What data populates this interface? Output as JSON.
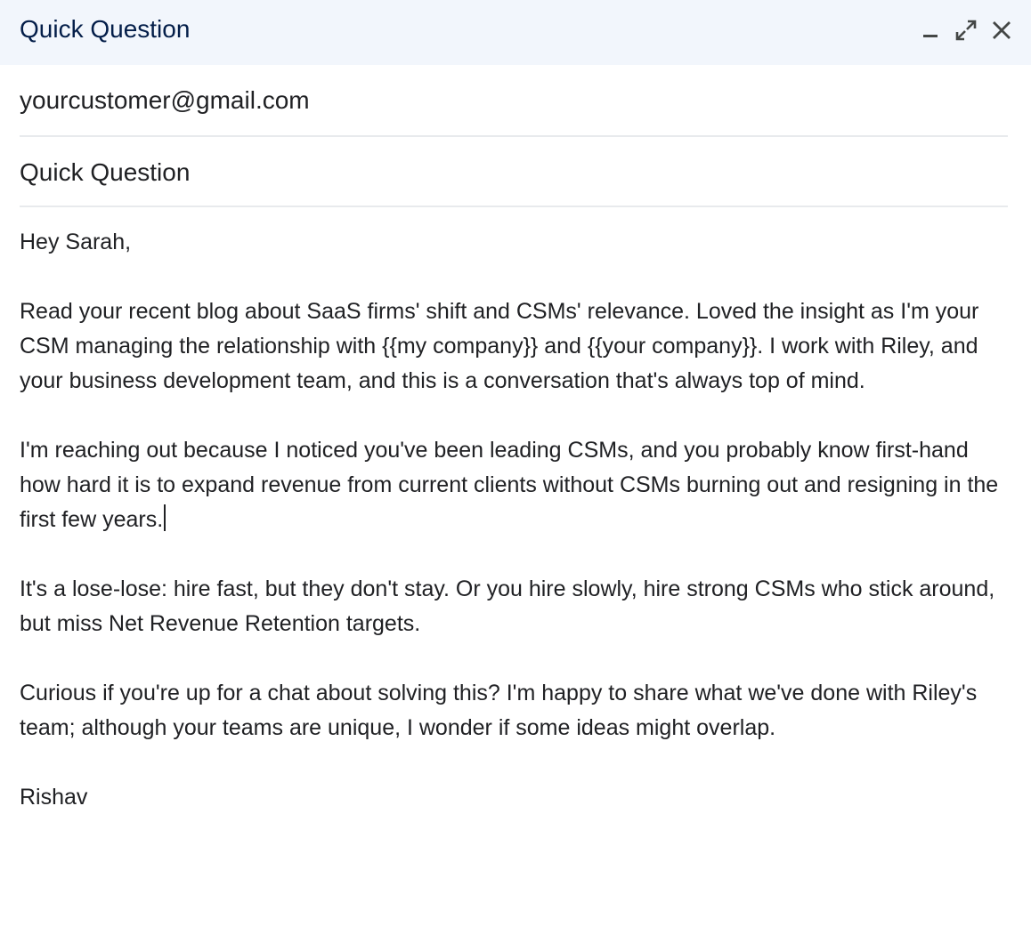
{
  "window": {
    "title": "Quick Question",
    "controls": [
      "minimize-icon",
      "expand-icon",
      "close-icon"
    ]
  },
  "compose": {
    "to": "yourcustomer@gmail.com",
    "subject": "Quick Question"
  },
  "message": {
    "greeting": "Hey Sarah,",
    "paragraphs": [
      "Read your recent blog about SaaS firms' shift and CSMs' relevance. Loved the insight as I'm your CSM managing the relationship with {{my company}} and {{your company}}. I work with Riley, and your business development team, and this is a conversation that's always top of mind.",
      "I'm reaching out because I noticed you've been leading CSMs, and you probably know first-hand how hard it is to expand revenue from current clients without CSMs burning out and resigning in the first few years.",
      "It's a lose-lose: hire fast, but they don't stay. Or you hire slowly, hire strong CSMs who stick around, but miss Net Revenue Retention targets.",
      "Curious if you're up for a chat about solving this? I'm happy to share what we've done with Riley's team; although your teams are unique, I wonder if some ideas might overlap."
    ],
    "signature": "Rishav"
  },
  "colors": {
    "titlebar_bg": "#f2f6fc",
    "title_text": "#041e49",
    "divider": "#e8eaed",
    "body_text": "#202124"
  }
}
